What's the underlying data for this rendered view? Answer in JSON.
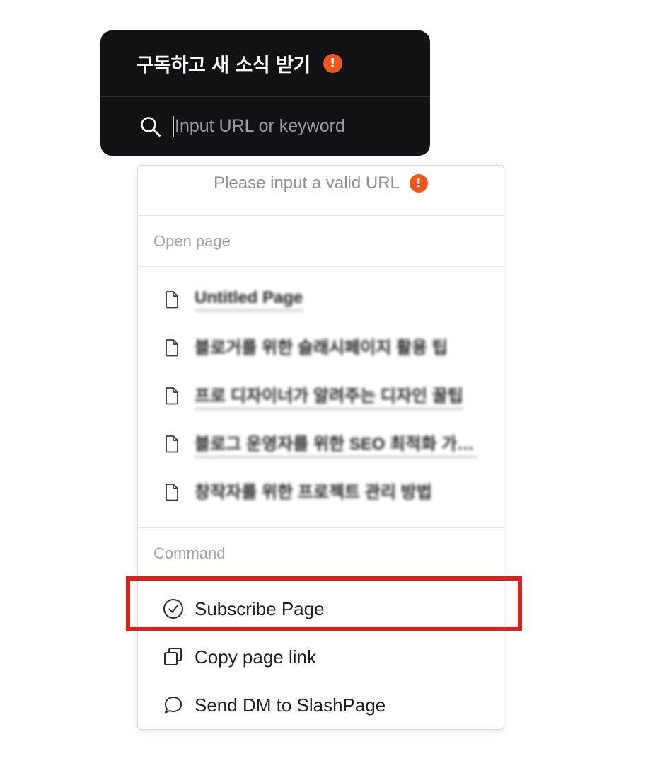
{
  "header": {
    "title": "구독하고 새 소식 받기",
    "alert_glyph": "!",
    "alert_color": "#f2561d"
  },
  "search": {
    "placeholder": "Input URL or keyword",
    "value": "",
    "icon": "search-icon"
  },
  "dropdown": {
    "warning_text": "Please input a valid URL",
    "warning_glyph": "!",
    "open_page_label": "Open page",
    "pages": [
      {
        "title": "Untitled Page",
        "icon": "document-icon"
      },
      {
        "title": "블로거를 위한 슬래시페이지 활용 팁",
        "icon": "document-icon"
      },
      {
        "title": "프로 디자이너가 알려주는 디자인 꿀팁",
        "icon": "document-icon"
      },
      {
        "title": "블로그 운영자를 위한 SEO 최적화 가이드",
        "icon": "document-icon"
      },
      {
        "title": "창작자를 위한 프로젝트 관리 방법",
        "icon": "document-icon"
      }
    ],
    "command_label": "Command",
    "commands": [
      {
        "label": "Subscribe Page",
        "icon": "check-circle-icon"
      },
      {
        "label": "Copy page link",
        "icon": "copy-icon"
      },
      {
        "label": "Send DM to SlashPage",
        "icon": "message-bubble-icon"
      }
    ]
  },
  "annotation": {
    "highlight_color": "#d9231a",
    "highlighted_item": "Subscribe Page"
  }
}
